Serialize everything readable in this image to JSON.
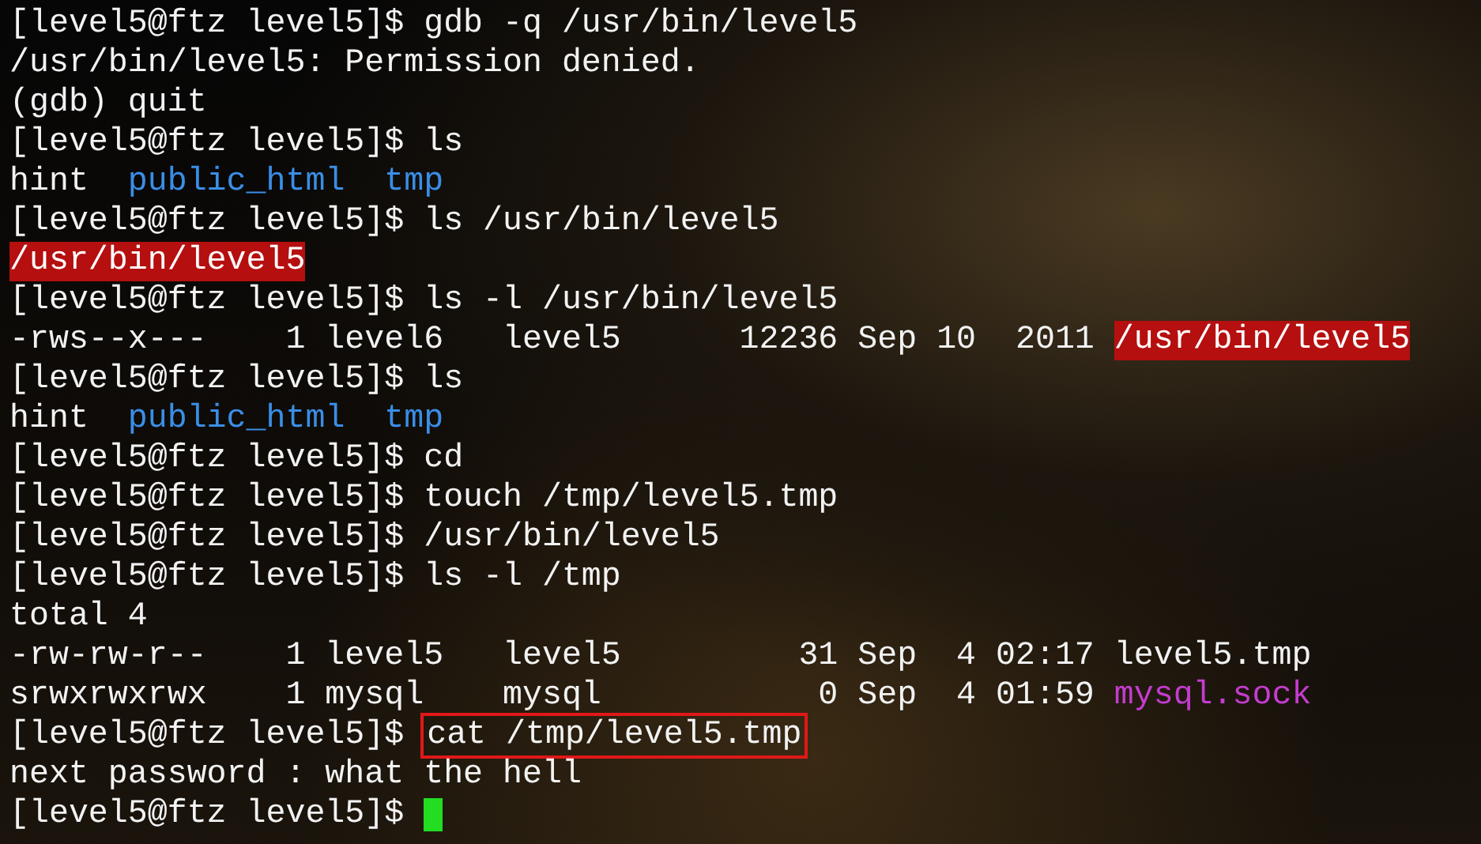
{
  "terminal": {
    "lines": [
      [
        {
          "kind": "plain",
          "text": "[level5@ftz level5]$ gdb -q /usr/bin/level5"
        }
      ],
      [
        {
          "kind": "plain",
          "text": "/usr/bin/level5: Permission denied."
        }
      ],
      [
        {
          "kind": "plain",
          "text": "(gdb) quit"
        }
      ],
      [
        {
          "kind": "plain",
          "text": "[level5@ftz level5]$ ls"
        }
      ],
      [
        {
          "kind": "plain",
          "text": "hint  "
        },
        {
          "kind": "directory",
          "text": "public_html"
        },
        {
          "kind": "directory",
          "text": "tmp"
        }
      ],
      [
        {
          "kind": "plain",
          "text": "[level5@ftz level5]$ ls /usr/bin/level5"
        }
      ],
      [
        {
          "kind": "setuid",
          "text": "/usr/bin/level5"
        }
      ],
      [
        {
          "kind": "plain",
          "text": "[level5@ftz level5]$ ls -l /usr/bin/level5"
        }
      ],
      [
        {
          "kind": "plain",
          "text": "-rws--x---    1 level6   level5      12236 Sep 10  2011 "
        },
        {
          "kind": "setuid",
          "text": "/usr/bin/level5"
        }
      ],
      [
        {
          "kind": "plain",
          "text": "[level5@ftz level5]$ ls"
        }
      ],
      [
        {
          "kind": "plain",
          "text": "hint  "
        },
        {
          "kind": "directory",
          "text": "public_html"
        },
        {
          "kind": "directory",
          "text": "tmp"
        }
      ],
      [
        {
          "kind": "plain",
          "text": "[level5@ftz level5]$ cd"
        }
      ],
      [
        {
          "kind": "plain",
          "text": "[level5@ftz level5]$ touch /tmp/level5.tmp"
        }
      ],
      [
        {
          "kind": "plain",
          "text": "[level5@ftz level5]$ /usr/bin/level5"
        }
      ],
      [
        {
          "kind": "plain",
          "text": "[level5@ftz level5]$ ls -l /tmp"
        }
      ],
      [
        {
          "kind": "plain",
          "text": "total 4"
        }
      ],
      [
        {
          "kind": "plain",
          "text": "-rw-rw-r--    1 level5   level5         31 Sep  4 02:17 level5.tmp"
        }
      ],
      [
        {
          "kind": "plain",
          "text": "srwxrwxrwx    1 mysql    mysql           0 Sep  4 01:59 "
        },
        {
          "kind": "socket",
          "text": "mysql.sock"
        }
      ],
      [
        {
          "kind": "plain",
          "text": "[level5@ftz level5]$ "
        },
        {
          "kind": "boxed",
          "text": "cat /tmp/level5.tmp"
        }
      ],
      [
        {
          "kind": "plain",
          "text": "next password : what the hell"
        }
      ],
      [
        {
          "kind": "plain",
          "text": "[level5@ftz level5]$ "
        },
        {
          "kind": "cursor"
        }
      ]
    ]
  }
}
